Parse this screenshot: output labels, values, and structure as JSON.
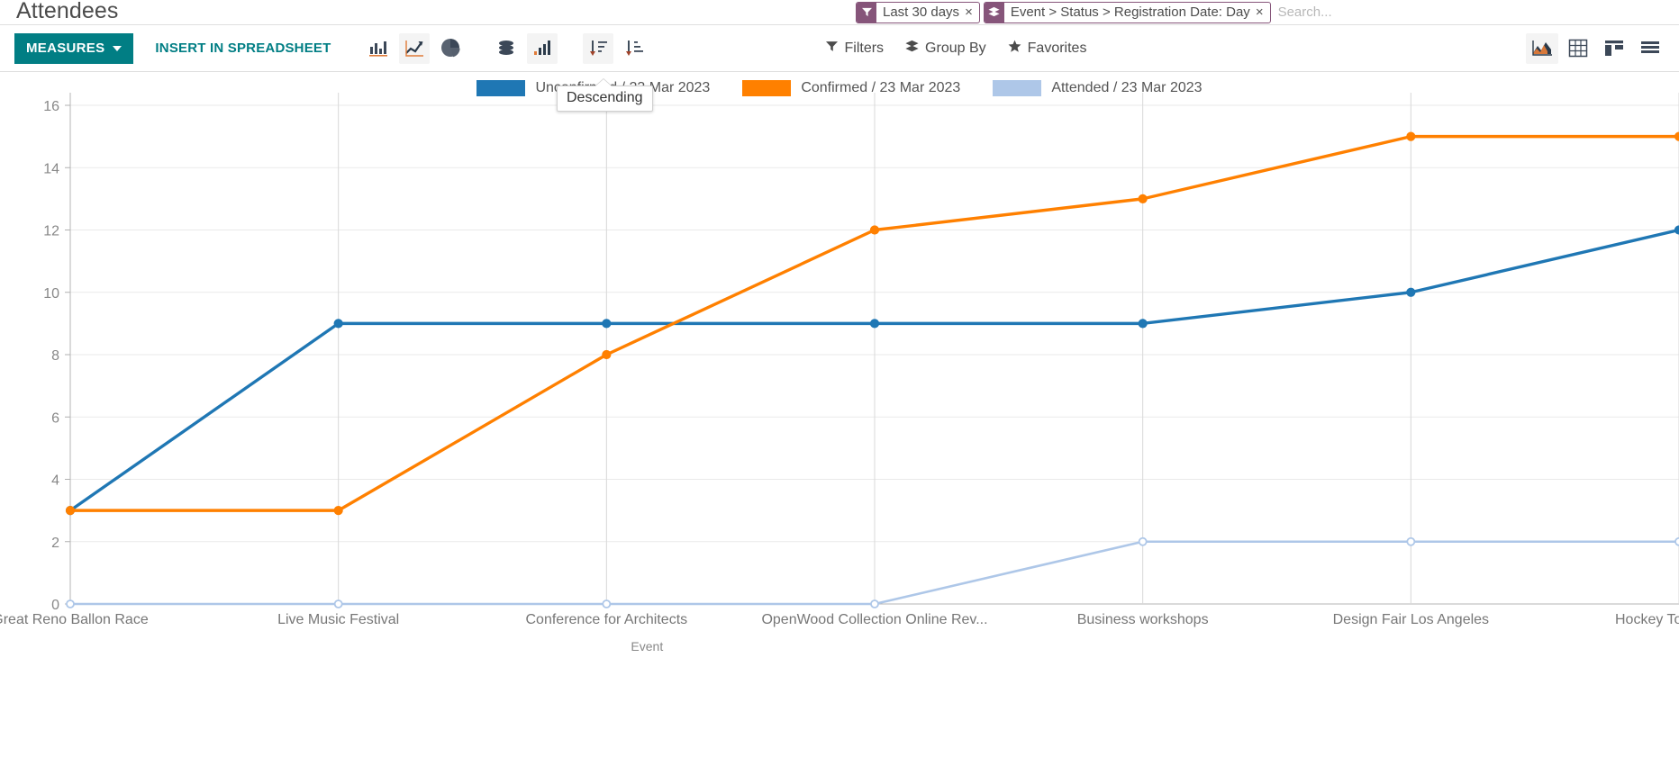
{
  "search": {
    "facets": [
      {
        "icon": "filter-icon",
        "label": "Last 30 days",
        "close": "×"
      },
      {
        "icon": "layers-icon",
        "label": "Event > Status > Registration Date: Day",
        "close": "×"
      }
    ],
    "placeholder": "Search..."
  },
  "header": {
    "title": "Attendees"
  },
  "toolbar": {
    "measures_label": "MEASURES",
    "insert_label": "INSERT IN SPREADSHEET",
    "chart_type_icons": [
      {
        "name": "bar-chart-icon",
        "title": "Bar Chart",
        "active": false
      },
      {
        "name": "line-chart-icon",
        "title": "Line Chart",
        "active": true
      },
      {
        "name": "pie-chart-icon",
        "title": "Pie Chart",
        "active": false
      }
    ],
    "mode_icons": [
      {
        "name": "stacked-icon",
        "title": "Stacked",
        "active": false
      },
      {
        "name": "cumulative-icon",
        "title": "Cumulative",
        "active": true
      }
    ],
    "sort_icons": [
      {
        "name": "sort-descending-icon",
        "title": "Descending",
        "active": true
      },
      {
        "name": "sort-ascending-icon",
        "title": "Ascending",
        "active": false
      }
    ],
    "tooltip": "Descending",
    "filters_label": "Filters",
    "group_by_label": "Group By",
    "favorites_label": "Favorites",
    "view_switcher": [
      {
        "name": "graph-view-icon",
        "title": "Graph",
        "active": true
      },
      {
        "name": "pivot-view-icon",
        "title": "Pivot",
        "active": false
      },
      {
        "name": "kanban-view-icon",
        "title": "Kanban",
        "active": false
      },
      {
        "name": "list-view-icon",
        "title": "List",
        "active": false
      }
    ]
  },
  "colors": {
    "brand_teal": "#017e84",
    "facet_purple": "#86557a",
    "series_unconfirmed": "#1f77b4",
    "series_confirmed": "#ff8000",
    "series_attended": "#aec7e8",
    "grid": "#eaeaea",
    "axis": "#c8c8c8"
  },
  "chart_data": {
    "type": "line",
    "title": "",
    "xlabel": "Event",
    "ylabel": "",
    "ylim": [
      0,
      16
    ],
    "yticks": [
      0,
      2,
      4,
      6,
      8,
      10,
      12,
      14,
      16
    ],
    "grid": true,
    "legend_position": "top",
    "categories": [
      "Great Reno Ballon Race",
      "Live Music Festival",
      "Conference for Architects",
      "OpenWood Collection Online Rev...",
      "Business workshops",
      "Design Fair Los Angeles",
      "Hockey Tournament"
    ],
    "series": [
      {
        "name": "Unconfirmed / 23 Mar 2023",
        "color": "#1f77b4",
        "values": [
          3,
          9,
          9,
          9,
          9,
          10,
          12
        ]
      },
      {
        "name": "Confirmed / 23 Mar 2023",
        "color": "#ff8000",
        "values": [
          3,
          3,
          8,
          12,
          13,
          15,
          15
        ]
      },
      {
        "name": "Attended / 23 Mar 2023",
        "color": "#aec7e8",
        "values": [
          0,
          0,
          0,
          0,
          2,
          2,
          2
        ]
      }
    ]
  }
}
